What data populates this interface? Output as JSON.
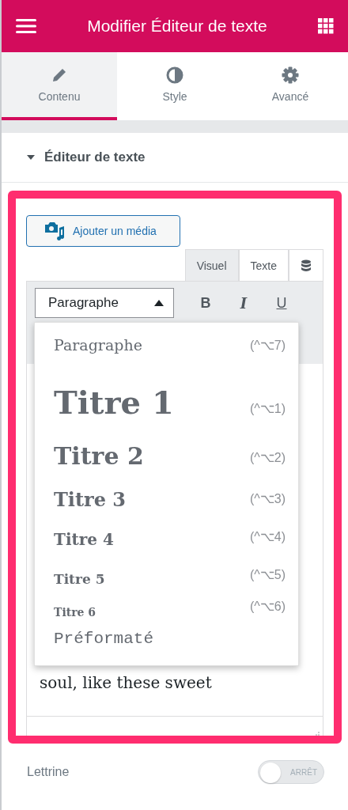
{
  "header": {
    "title": "Modifier Éditeur de texte"
  },
  "tabs": [
    {
      "label": "Contenu",
      "selected": true
    },
    {
      "label": "Style",
      "selected": false
    },
    {
      "label": "Avancé",
      "selected": false
    }
  ],
  "section": {
    "title": "Éditeur de texte",
    "expanded": true
  },
  "editor": {
    "media_button": "Ajouter un média",
    "mode_tabs": [
      {
        "label": "Visuel",
        "selected": true
      },
      {
        "label": "Texte",
        "selected": false
      }
    ],
    "format_select": {
      "value": "Paragraphe",
      "open": true
    },
    "format_buttons": [
      {
        "label": "B",
        "kind": "bold"
      },
      {
        "label": "I",
        "kind": "italic"
      },
      {
        "label": "U",
        "kind": "underline"
      }
    ],
    "format_options": [
      {
        "label": "Paragraphe",
        "shortcut": "(^⌥7)",
        "kind": "p"
      },
      {
        "label": "Titre 1",
        "shortcut": "(^⌥1)",
        "kind": "h1"
      },
      {
        "label": "Titre 2",
        "shortcut": "(^⌥2)",
        "kind": "h2"
      },
      {
        "label": "Titre 3",
        "shortcut": "(^⌥3)",
        "kind": "h3"
      },
      {
        "label": "Titre 4",
        "shortcut": "(^⌥4)",
        "kind": "h4"
      },
      {
        "label": "Titre 5",
        "shortcut": "(^⌥5)",
        "kind": "h5"
      },
      {
        "label": "Titre 6",
        "shortcut": "(^⌥6)",
        "kind": "h6"
      },
      {
        "label": "Préformaté",
        "kind": "pre"
      }
    ],
    "body_text": "soul, like these sweet"
  },
  "drop_cap": {
    "label": "Lettrine",
    "on": false,
    "state_label": "ARRÊT"
  }
}
